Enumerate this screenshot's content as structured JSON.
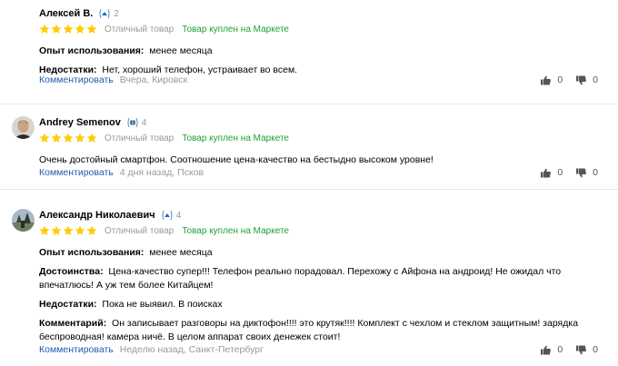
{
  "reviews": [
    {
      "author": "Алексей В.",
      "badge_icon": "yandex-plus-badge-icon",
      "badge_count": "2",
      "stars": 5,
      "rating_text": "Отличный товар",
      "bought_text": "Товар куплен на Маркете",
      "experience_label": "Опыт использования:",
      "experience_value": "менее месяца",
      "cons_label": "Недостатки:",
      "cons_value": "Нет, хороший телефон, устраивает во всем.",
      "comment_link": "Комментировать",
      "meta": "Вчера, Кировск",
      "likes": "0",
      "dislikes": "0"
    },
    {
      "author": "Andrey Semenov",
      "badge_icon": "plus-badge-icon",
      "badge_count": "4",
      "stars": 5,
      "rating_text": "Отличный товар",
      "bought_text": "Товар куплен на Маркете",
      "text": "Очень достойный смартфон. Соотношение цена-качество на бестыдно высоком уровне!",
      "comment_link": "Комментировать",
      "meta": "4 дня назад, Псков",
      "likes": "0",
      "dislikes": "0"
    },
    {
      "author": "Александр Николаевич",
      "badge_icon": "yandex-plus-badge-icon",
      "badge_count": "4",
      "stars": 5,
      "rating_text": "Отличный товар",
      "bought_text": "Товар куплен на Маркете",
      "experience_label": "Опыт использования:",
      "experience_value": "менее месяца",
      "pros_label": "Достоинства:",
      "pros_value": "Цена-качество супер!!! Телефон реально порадовал. Перехожу с Айфона на андроид! Не ожидал что впечатлюсь! А уж тем более Китайцем!",
      "cons_label": "Недостатки:",
      "cons_value": "Пока не выявил. В поисках",
      "comment_label": "Комментарий:",
      "comment_value": "Он записывает разговоры на диктофон!!!! это крутяк!!!! Комплект с чехлом и стеклом защитным! зарядка беспроводная! камера ничё. В целом аппарат своих денежек стоит!",
      "comment_link": "Комментировать",
      "meta": "Неделю назад, Санкт-Петербург",
      "likes": "0",
      "dislikes": "0"
    }
  ],
  "colors": {
    "star": "#ffcc00",
    "bought": "#21a038",
    "link": "#1e5bad",
    "muted": "#999999"
  }
}
